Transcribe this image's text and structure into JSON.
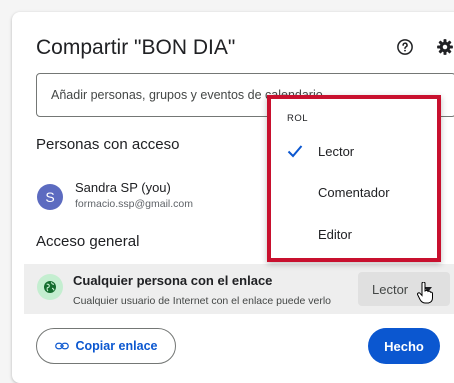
{
  "dialog": {
    "title": "Compartir \"BON DIA\"",
    "add_placeholder": "Añadir personas, grupos y eventos de calendario"
  },
  "people": {
    "heading": "Personas con acceso",
    "user": {
      "avatar_letter": "S",
      "name": "Sandra SP (you)",
      "email": "formacio.ssp@gmail.com"
    }
  },
  "general": {
    "heading": "Acceso general",
    "access_title": "Cualquier persona con el enlace",
    "access_sub": "Cualquier usuario de Internet con el enlace puede verlo",
    "role": "Lector"
  },
  "role_menu": {
    "header": "ROL",
    "items": [
      {
        "label": "Lector",
        "selected": true
      },
      {
        "label": "Comentador",
        "selected": false
      },
      {
        "label": "Editor",
        "selected": false
      }
    ]
  },
  "footer": {
    "copy_label": "Copiar enlace",
    "done_label": "Hecho"
  },
  "colors": {
    "accent": "#0b57d0",
    "highlight_border": "#c8102e",
    "globe_bg": "#c4eed0",
    "avatar_bg": "#5c6bc0"
  },
  "icons": [
    "help-icon",
    "settings-icon",
    "globe-icon",
    "check-icon",
    "link-icon",
    "pointer-cursor-icon",
    "caret-down-icon"
  ]
}
